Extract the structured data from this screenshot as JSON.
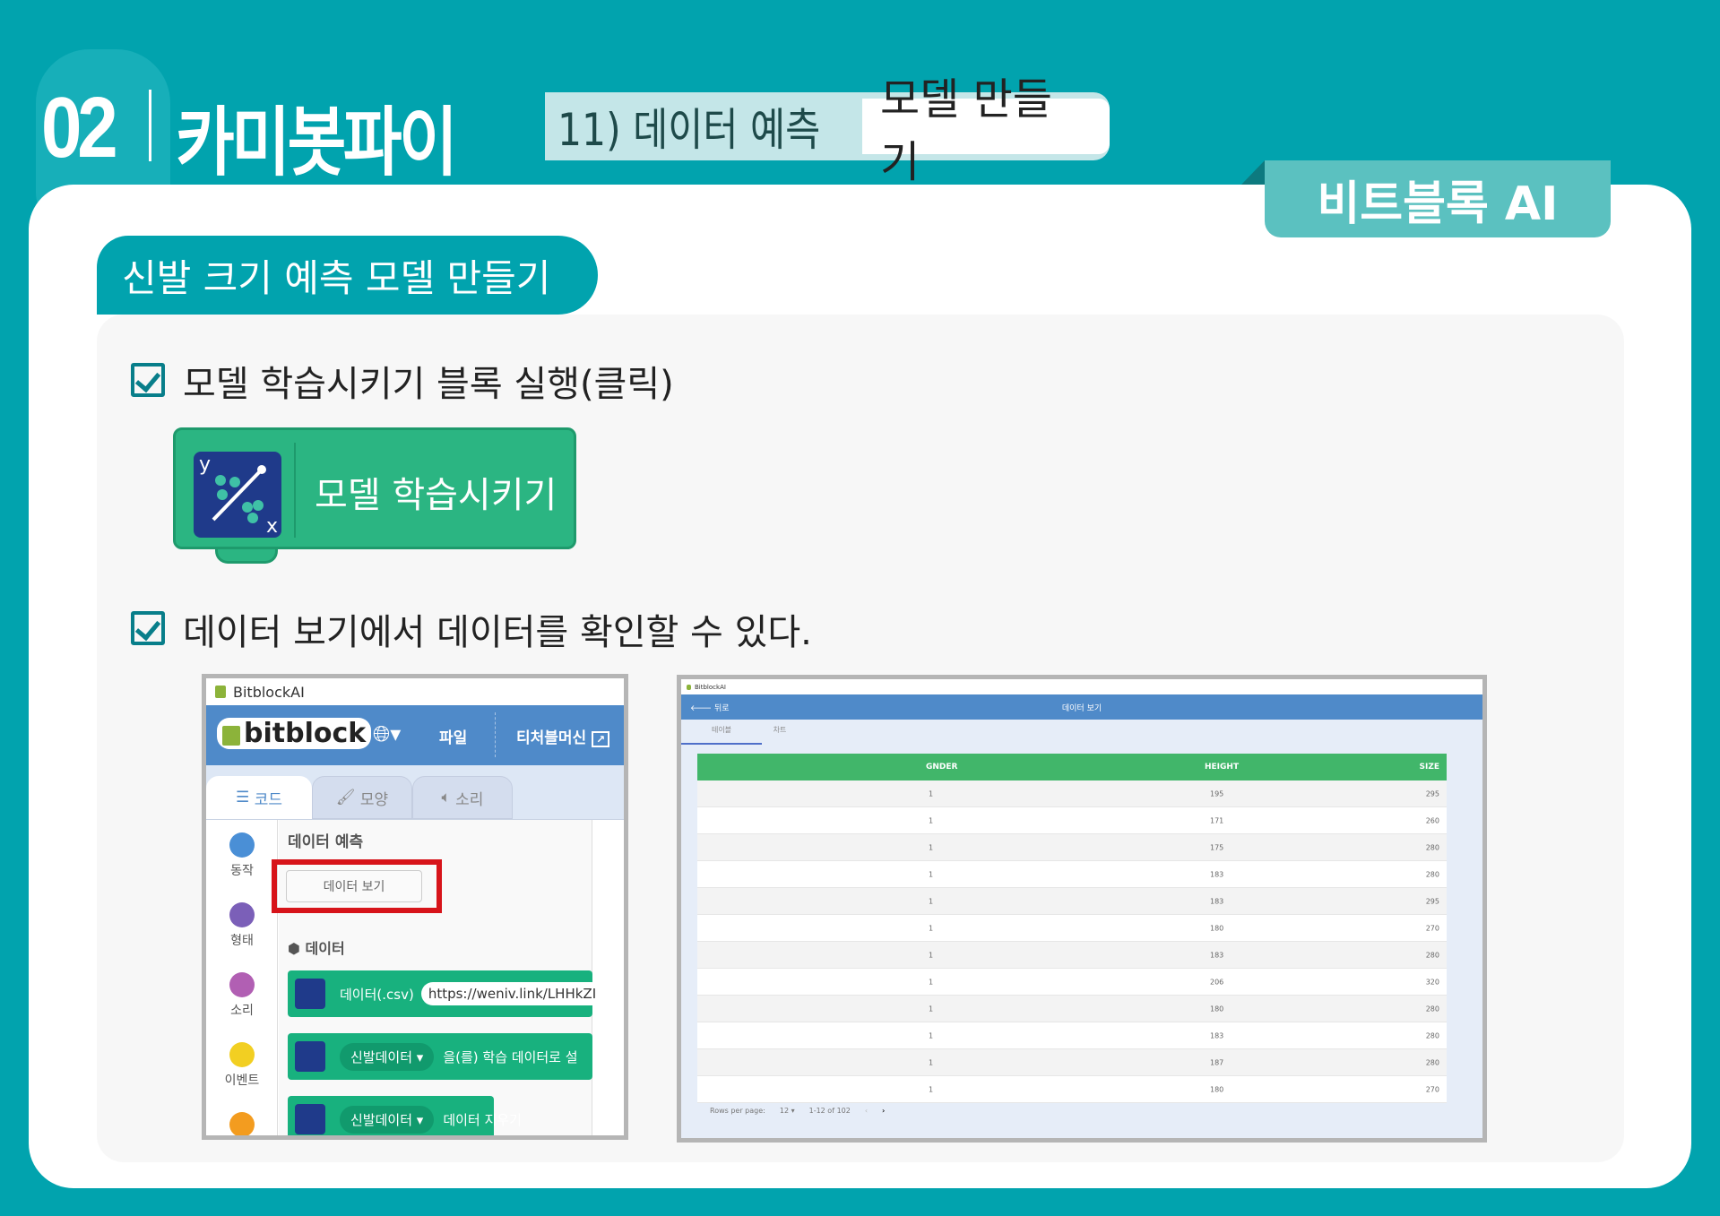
{
  "header": {
    "number": "02",
    "brand": "카미봇파이",
    "subtitle": "11) 데이터 예측",
    "subtitle_highlight": "모델 만들기",
    "tag": "비트블록 AI"
  },
  "section": {
    "title": "신발 크기 예측 모델 만들기"
  },
  "steps": [
    {
      "text": "모델 학습시키기 블록 실행(클릭)"
    },
    {
      "text": "데이터 보기에서 데이터를 확인할 수 있다."
    }
  ],
  "block": {
    "label": "모델 학습시키기",
    "icon_y": "y",
    "icon_x": "x"
  },
  "left_shot": {
    "window_title": "BitblockAI",
    "logo": "bitblock",
    "menu": {
      "language_icon": "globe-icon",
      "file": "파일",
      "teachable": "티처블머신"
    },
    "tabs": [
      "코드",
      "모양",
      "소리"
    ],
    "categories": [
      {
        "label": "동작",
        "color": "#4a8fd6"
      },
      {
        "label": "형태",
        "color": "#7b5fb8"
      },
      {
        "label": "소리",
        "color": "#b15fb3"
      },
      {
        "label": "이벤트",
        "color": "#f2cf22"
      },
      {
        "label": "",
        "color": "#f39c1f"
      }
    ],
    "palette_title": "데이터 예측",
    "view_data_button": "데이터 보기",
    "data_section": "데이터",
    "blocks": [
      {
        "label": "데이터(.csv)",
        "value": "https://weniv.link/LHHkZI"
      },
      {
        "dropdown": "신발데이터",
        "label": "을(를) 학습 데이터로 설"
      },
      {
        "dropdown": "신발데이터",
        "label": "데이터 지우기"
      }
    ],
    "highlight_color": "#d7141a"
  },
  "right_shot": {
    "window_title": "BitblockAI",
    "back": "뒤로",
    "title": "데이터 보기",
    "tabs": [
      "테이블",
      "차트"
    ],
    "columns": [
      "GNDER",
      "HEIGHT",
      "SIZE"
    ],
    "rows": [
      [
        "1",
        "195",
        "295"
      ],
      [
        "1",
        "171",
        "260"
      ],
      [
        "1",
        "175",
        "280"
      ],
      [
        "1",
        "183",
        "280"
      ],
      [
        "1",
        "183",
        "295"
      ],
      [
        "1",
        "180",
        "270"
      ],
      [
        "1",
        "183",
        "280"
      ],
      [
        "1",
        "206",
        "320"
      ],
      [
        "1",
        "180",
        "280"
      ],
      [
        "1",
        "183",
        "280"
      ],
      [
        "1",
        "187",
        "280"
      ],
      [
        "1",
        "180",
        "270"
      ]
    ],
    "footer": {
      "rows_per_page_label": "Rows per page:",
      "rows_per_page": "12",
      "range": "1-12 of 102",
      "prev": "‹",
      "next": "›"
    }
  }
}
